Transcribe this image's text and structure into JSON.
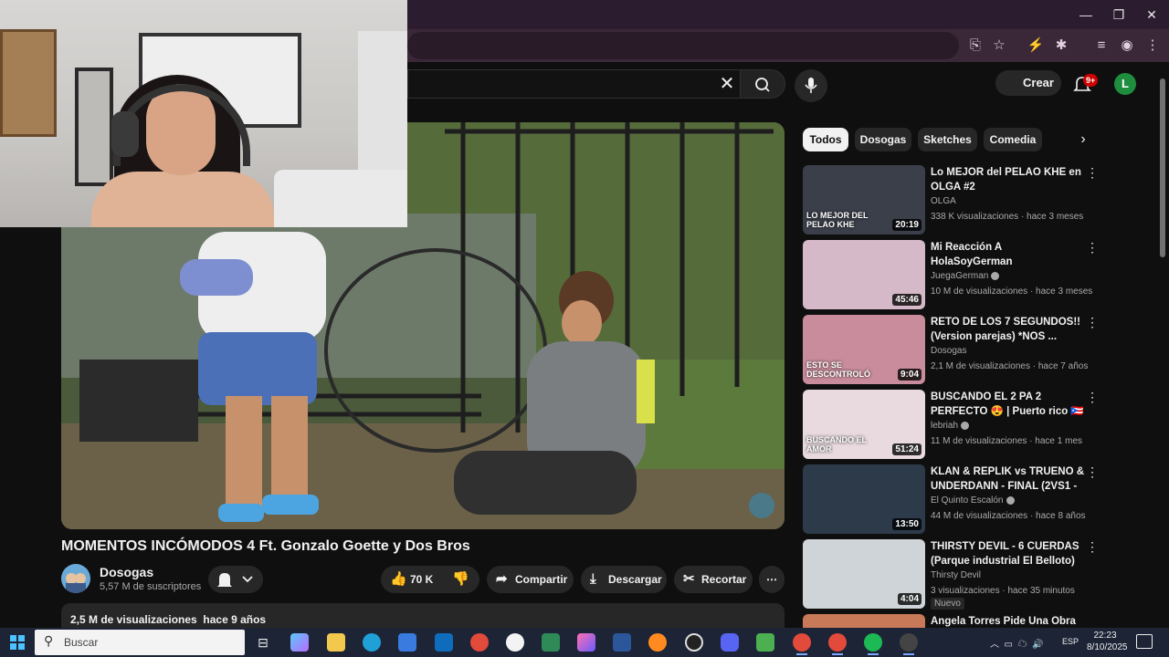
{
  "header": {
    "search_clear_icon": "close-icon",
    "create_label": "Crear",
    "notifications_count": "9+",
    "avatar_letter": "L"
  },
  "video": {
    "title": "MOMENTOS INCÓMODOS 4 Ft. Gonzalo Goette y Dos Bros",
    "channel": "Dosogas",
    "subscribers": "5,57 M de suscriptores",
    "likes": "70 K",
    "share_label": "Compartir",
    "download_label": "Descargar",
    "clip_label": "Recortar",
    "views": "2,5 M de visualizaciones",
    "age": "hace 9 años"
  },
  "chips": [
    "Todos",
    "Dosogas",
    "Sketches",
    "Comedia"
  ],
  "recommendations": [
    {
      "title": "Lo MEJOR del PELAO KHE en OLGA #2",
      "channel": "OLGA",
      "verified": false,
      "meta": "338 K visualizaciones · hace 3 meses",
      "duration": "20:19",
      "thumb_color": "#3b3f4a",
      "thumb_text": "LO MEJOR DEL PELAO KHE",
      "is_new": false
    },
    {
      "title": "Mi Reacción A HolaSoyGerman",
      "channel": "JuegaGerman",
      "verified": true,
      "meta": "10 M de visualizaciones · hace 3 meses",
      "duration": "45:46",
      "thumb_color": "#d6b9c8",
      "thumb_text": "",
      "is_new": false
    },
    {
      "title": "RETO DE LOS 7 SEGUNDOS!! (Version parejas) *NOS ...",
      "channel": "Dosogas",
      "verified": false,
      "meta": "2,1 M de visualizaciones · hace 7 años",
      "duration": "9:04",
      "thumb_color": "#c98c9c",
      "thumb_text": "ESTO SE DESCONTROLÓ",
      "is_new": false
    },
    {
      "title": "BUSCANDO EL 2 PA 2 PERFECTO 😍 | Puerto rico 🇵🇷",
      "channel": "lebriah",
      "verified": true,
      "meta": "11 M de visualizaciones · hace 1 mes",
      "duration": "51:24",
      "thumb_color": "#e8dadf",
      "thumb_text": "BUSCANDO EL AMOR",
      "is_new": false
    },
    {
      "title": "KLAN & REPLIK vs TRUENO & UNDERDANN - FINAL (2VS1 - ...",
      "channel": "El Quinto Escalón",
      "verified": true,
      "meta": "44 M de visualizaciones · hace 8 años",
      "duration": "13:50",
      "thumb_color": "#2c3a4a",
      "thumb_text": "",
      "is_new": false
    },
    {
      "title": "THIRSTY DEVIL - 6 CUERDAS (Parque industrial El Belloto)",
      "channel": "Thirsty Devil",
      "verified": false,
      "meta": "3 visualizaciones · hace 35 minutos",
      "duration": "4:04",
      "thumb_color": "#cfd4d8",
      "thumb_text": "",
      "is_new": true,
      "new_label": "Nuevo"
    },
    {
      "title": "Angela Torres Pide Una Obra",
      "channel": "",
      "verified": false,
      "meta": "",
      "duration": "",
      "thumb_color": "#c87a58",
      "thumb_text": "",
      "is_new": false
    }
  ],
  "taskbar": {
    "search_placeholder": "Buscar",
    "language": "ESP",
    "time": "22:23",
    "date": "8/10/2025"
  }
}
